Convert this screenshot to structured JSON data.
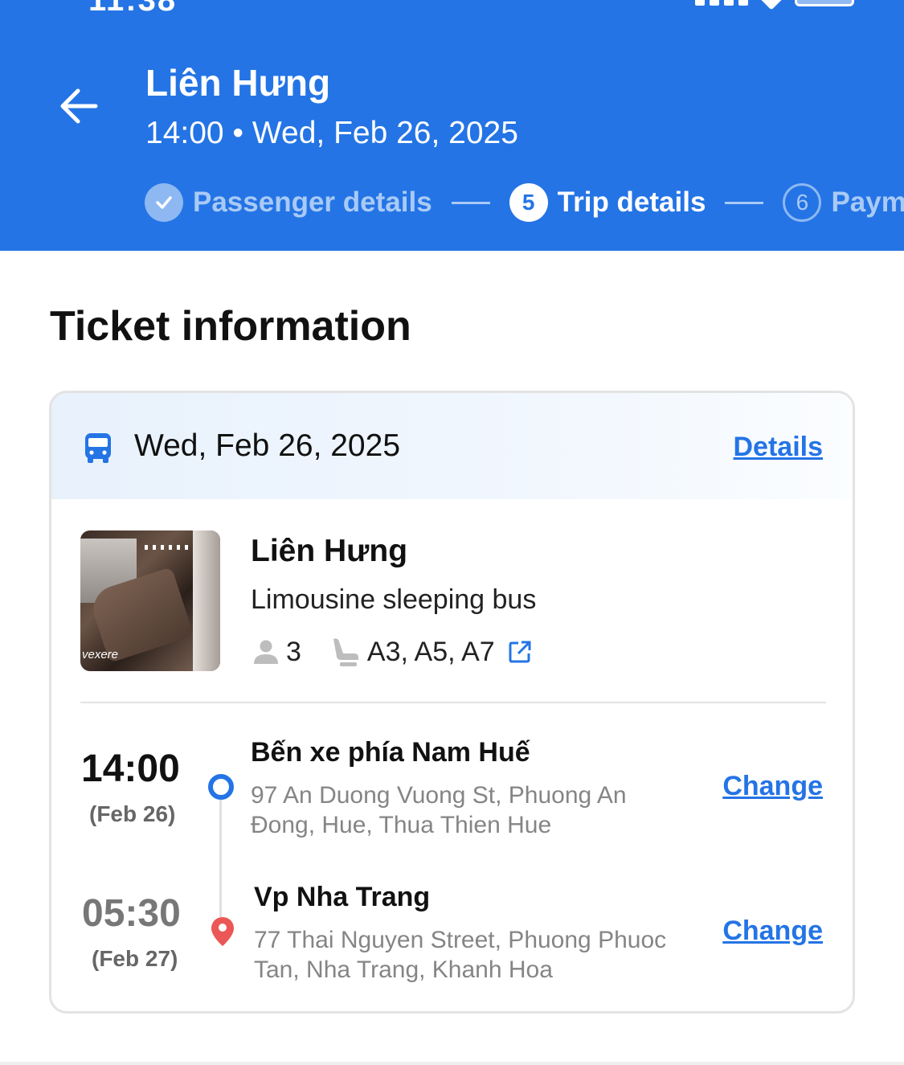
{
  "header": {
    "title": "Liên Hưng",
    "subtitle": "14:00 • Wed, Feb 26, 2025",
    "steps": [
      {
        "label": "Passenger details",
        "number": "",
        "state": "done"
      },
      {
        "label": "Trip details",
        "number": "5",
        "state": "active"
      },
      {
        "label": "Payment",
        "number": "6",
        "state": "next"
      }
    ]
  },
  "section": {
    "title": "Ticket information"
  },
  "ticket": {
    "date": "Wed, Feb 26, 2025",
    "details_label": "Details",
    "operator": "Liên Hưng",
    "bus_type": "Limousine sleeping bus",
    "passenger_count": "3",
    "seats": "A3, A5, A7",
    "photo_watermark": "vexere",
    "pickup": {
      "time": "14:00",
      "date": "(Feb 26)",
      "name": "Bến xe phía Nam Huế",
      "address": "97 An Duong Vuong St, Phuong An Đong, Hue, Thua Thien Hue",
      "change_label": "Change"
    },
    "dropoff": {
      "time": "05:30",
      "date": "(Feb 27)",
      "name": "Vp Nha Trang",
      "address": "77 Thai Nguyen Street, Phuong Phuoc Tan, Nha Trang, Khanh Hoa",
      "change_label": "Change"
    }
  },
  "icons": {
    "back": "arrow-left-icon",
    "check": "check-circle-icon",
    "bus": "bus-icon",
    "person": "person-icon",
    "seat": "seat-icon",
    "external": "external-link-icon",
    "pickup": "pickup-dot-icon",
    "dropoff": "location-pin-icon"
  },
  "colors": {
    "primary": "#2474E5",
    "pin": "#EB5757",
    "muted_text": "#858585",
    "dropoff_time": "#777777"
  }
}
